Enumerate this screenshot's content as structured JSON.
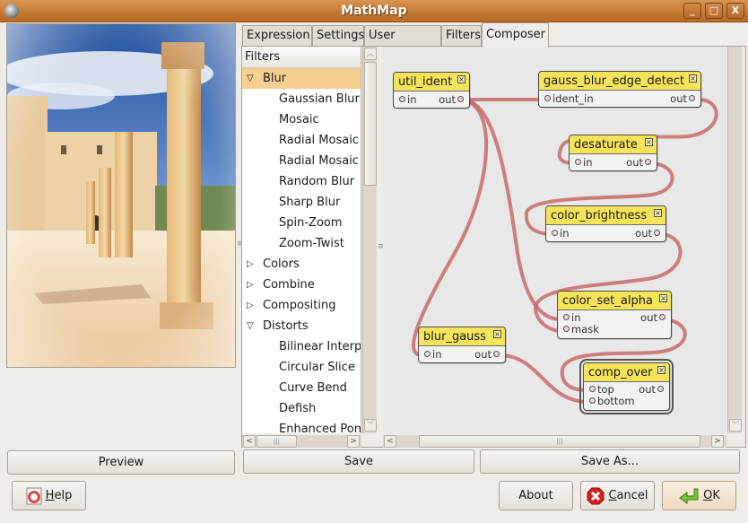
{
  "window": {
    "title": "MathMap",
    "buttons": {
      "minimize": "_",
      "maximize": "□",
      "close": "X"
    }
  },
  "preview": {
    "button_label": "Preview",
    "image_description": "Photo of ancient stone columns in a courtyard with blue sky, blurred/glow effect"
  },
  "tabs": [
    {
      "label": "Expression",
      "active": false
    },
    {
      "label": "Settings",
      "active": false
    },
    {
      "label": "User Values",
      "active": false
    },
    {
      "label": "Filters",
      "active": false
    },
    {
      "label": "Composer",
      "active": true
    }
  ],
  "filters_tree": {
    "header": "Filters",
    "rows": [
      {
        "label": "Blur",
        "type": "category",
        "expanded": true,
        "selected": true
      },
      {
        "label": "Gaussian Blur",
        "type": "leaf"
      },
      {
        "label": "Mosaic",
        "type": "leaf"
      },
      {
        "label": "Radial Mosaic",
        "type": "leaf"
      },
      {
        "label": "Radial Mosaic",
        "type": "leaf"
      },
      {
        "label": "Random Blur",
        "type": "leaf"
      },
      {
        "label": "Sharp Blur",
        "type": "leaf"
      },
      {
        "label": "Spin-Zoom",
        "type": "leaf"
      },
      {
        "label": "Zoom-Twist",
        "type": "leaf"
      },
      {
        "label": "Colors",
        "type": "category",
        "expanded": false
      },
      {
        "label": "Combine",
        "type": "category",
        "expanded": false
      },
      {
        "label": "Compositing",
        "type": "category",
        "expanded": false
      },
      {
        "label": "Distorts",
        "type": "category",
        "expanded": true
      },
      {
        "label": "Bilinear Interpolation",
        "type": "leaf"
      },
      {
        "label": "Circular Slice",
        "type": "leaf"
      },
      {
        "label": "Curve Bend",
        "type": "leaf"
      },
      {
        "label": "Defish",
        "type": "leaf"
      },
      {
        "label": "Enhanced Ponder",
        "type": "leaf"
      }
    ]
  },
  "composer": {
    "link_color": "#c96a6a",
    "node_header_color": "#f5e35a",
    "nodes": {
      "util_ident": {
        "title": "util_ident",
        "inputs": [
          "in"
        ],
        "output": "out"
      },
      "gauss_blur_edge_detect": {
        "title": "gauss_blur_edge_detect",
        "inputs": [
          "ident_in"
        ],
        "output": "out"
      },
      "desaturate": {
        "title": "desaturate",
        "inputs": [
          "in"
        ],
        "output": "out"
      },
      "color_brightness": {
        "title": "color_brightness",
        "inputs": [
          "in"
        ],
        "output": "out"
      },
      "color_set_alpha": {
        "title": "color_set_alpha",
        "inputs": [
          "in",
          "mask"
        ],
        "output": "out"
      },
      "blur_gauss": {
        "title": "blur_gauss",
        "inputs": [
          "in"
        ],
        "output": "out"
      },
      "comp_over": {
        "title": "comp_over",
        "inputs": [
          "top",
          "bottom"
        ],
        "output": "out",
        "selected": true
      }
    },
    "links": [
      {
        "from": "util_ident.out",
        "to": "gauss_blur_edge_detect.ident_in"
      },
      {
        "from": "gauss_blur_edge_detect.out",
        "to": "desaturate.in"
      },
      {
        "from": "desaturate.out",
        "to": "color_brightness.in"
      },
      {
        "from": "color_brightness.out",
        "to": "color_set_alpha.mask"
      },
      {
        "from": "util_ident.out",
        "to": "color_set_alpha.in"
      },
      {
        "from": "util_ident.out",
        "to": "blur_gauss.in"
      },
      {
        "from": "color_set_alpha.out",
        "to": "comp_over.top"
      },
      {
        "from": "blur_gauss.out",
        "to": "comp_over.bottom"
      }
    ]
  },
  "notebook_buttons": {
    "save": "Save",
    "save_as": "Save As..."
  },
  "dialog_buttons": {
    "help": {
      "mnemonic": "H",
      "rest": "elp"
    },
    "about": "About",
    "cancel": {
      "mnemonic": "C",
      "rest": "ancel"
    },
    "ok": {
      "mnemonic": "O",
      "rest": "K"
    }
  },
  "icons": {
    "app": "gimp-wilber-icon",
    "help": "lifebuoy-icon",
    "cancel": "stop-x-icon",
    "ok": "green-return-arrow-icon",
    "node_close": "close-box-icon",
    "expander_open": "▽",
    "expander_closed": "▷"
  }
}
